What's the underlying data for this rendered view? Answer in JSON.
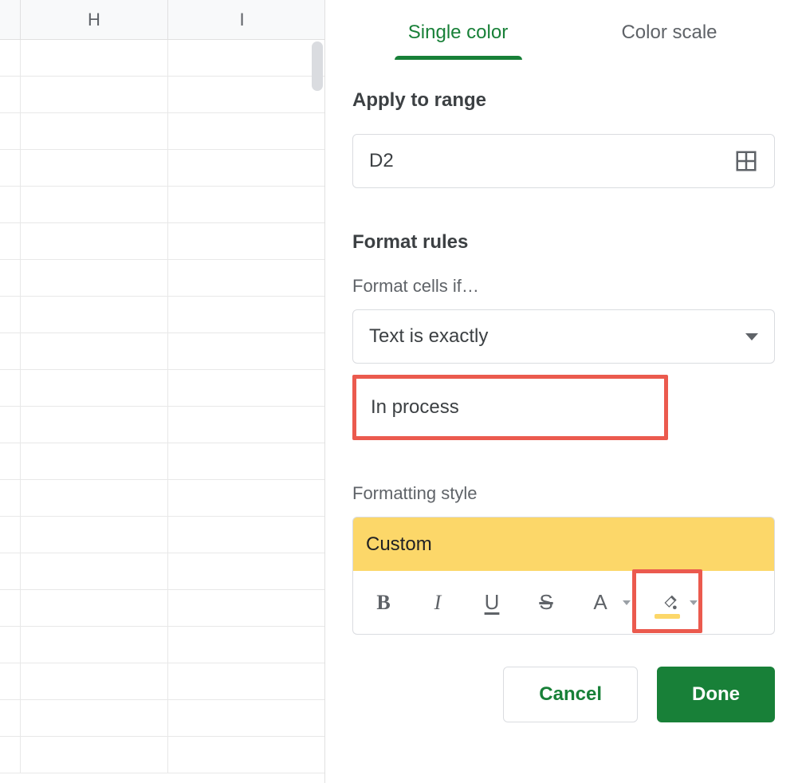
{
  "sheet": {
    "col_headers": [
      "",
      "H",
      "I"
    ],
    "row_count": 20
  },
  "panel": {
    "tabs": {
      "single_color": "Single color",
      "color_scale": "Color scale"
    },
    "apply_to_range_label": "Apply to range",
    "range_value": "D2",
    "format_rules_label": "Format rules",
    "format_cells_if_label": "Format cells if…",
    "condition_selected": "Text is exactly",
    "condition_value": "In process",
    "formatting_style_label": "Formatting style",
    "style_name": "Custom",
    "toolbar": {
      "bold": "B",
      "italic": "I",
      "underline": "U",
      "strike": "S",
      "textcolor_letter": "A"
    },
    "buttons": {
      "cancel": "Cancel",
      "done": "Done"
    },
    "colors": {
      "accent_green": "#188038",
      "highlight_red": "#eb5a4e",
      "preview_fill": "#fcd769"
    }
  }
}
